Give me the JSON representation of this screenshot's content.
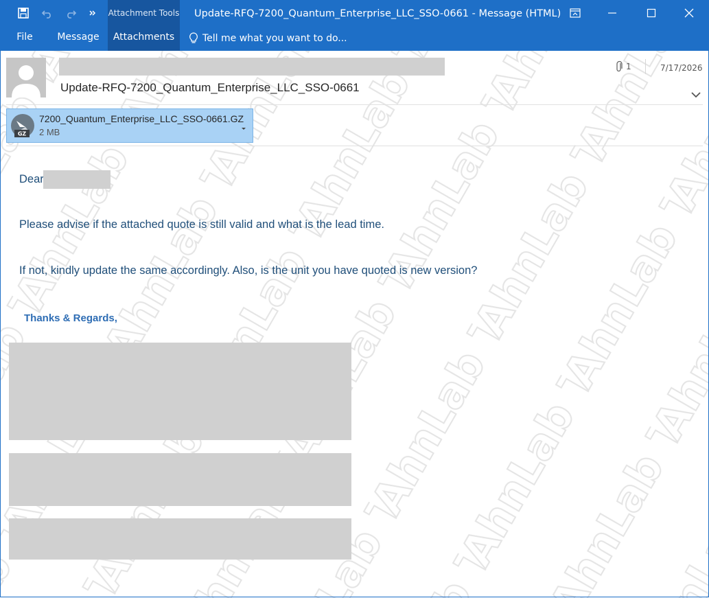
{
  "titlebar": {
    "title": "Update-RFQ-7200_Quantum_Enterprise_LLC_SSO-0661 - Message (HTML)",
    "context_group": "Attachment Tools"
  },
  "ribbon": {
    "tabs": [
      {
        "label": "File"
      },
      {
        "label": "Message"
      },
      {
        "label": "Attachments",
        "active": true
      }
    ],
    "tell_me": "Tell me what you want to do..."
  },
  "message": {
    "subject": "Update-RFQ-7200_Quantum_Enterprise_LLC_SSO-0661",
    "attachment_count": "1",
    "date": "7/17/2026"
  },
  "attachment": {
    "name": "7200_Quantum_Enterprise_LLC_SSO-0661.GZ",
    "size": "2 MB",
    "type_badge": "GZ"
  },
  "body": {
    "greeting": "Dear",
    "line1": "Please advise if the attached quote is still valid and what is the lead time.",
    "line2": "If not, kindly update the same accordingly. Also, is the unit you have quoted is new version?",
    "regards": "Thanks & Regards,"
  },
  "watermark": {
    "text": "AhnLab TIP"
  },
  "colors": {
    "ribbon": "#1e6fc7",
    "ribbon_active": "#17569f",
    "attachment_bg": "#a9d2f5",
    "body_text": "#1f4e79",
    "regards": "#2e6db4"
  }
}
